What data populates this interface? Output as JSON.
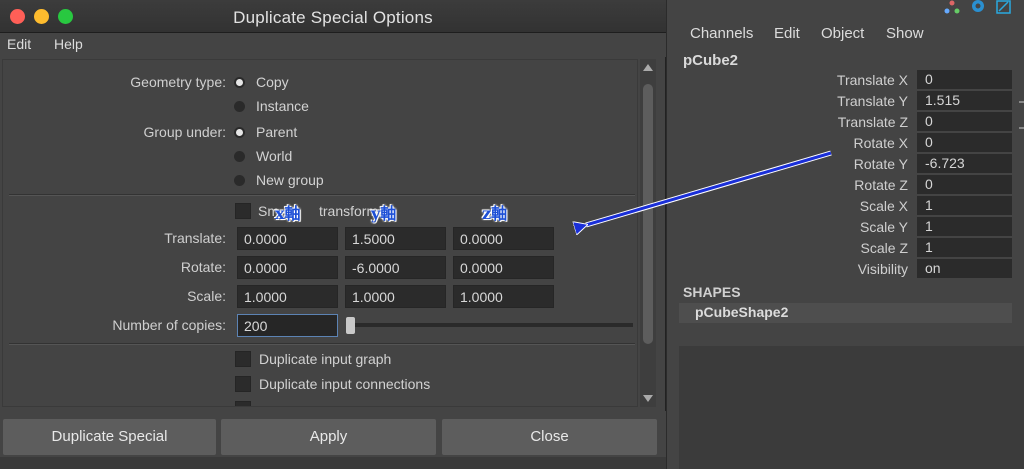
{
  "dialog": {
    "title": "Duplicate Special Options",
    "menu": [
      "Edit",
      "Help"
    ],
    "geometry_type": {
      "label": "Geometry type:",
      "options": [
        {
          "label": "Copy",
          "selected": true
        },
        {
          "label": "Instance",
          "selected": false
        }
      ]
    },
    "group_under": {
      "label": "Group under:",
      "options": [
        {
          "label": "Parent",
          "selected": true
        },
        {
          "label": "World",
          "selected": false
        },
        {
          "label": "New group",
          "selected": false
        }
      ]
    },
    "smart_transform": {
      "label_visible": "Sm",
      "label_tail": "transform"
    },
    "axis_annotations": [
      "x軸",
      "y軸",
      "z軸"
    ],
    "translate": {
      "label": "Translate:",
      "values": [
        "0.0000",
        "1.5000",
        "0.0000"
      ]
    },
    "rotate": {
      "label": "Rotate:",
      "values": [
        "0.0000",
        "-6.0000",
        "0.0000"
      ]
    },
    "scale": {
      "label": "Scale:",
      "values": [
        "1.0000",
        "1.0000",
        "1.0000"
      ]
    },
    "copies": {
      "label": "Number of copies:",
      "value": "200"
    },
    "checks": [
      {
        "label": "Duplicate input graph",
        "checked": false
      },
      {
        "label": "Duplicate input connections",
        "checked": false
      }
    ],
    "buttons": {
      "duplicate": "Duplicate Special",
      "apply": "Apply",
      "close": "Close"
    }
  },
  "channel_box": {
    "menu": [
      "Channels",
      "Edit",
      "Object",
      "Show"
    ],
    "object": "pCube2",
    "attributes": [
      {
        "label": "Translate X",
        "value": "0"
      },
      {
        "label": "Translate Y",
        "value": "1.515"
      },
      {
        "label": "Translate Z",
        "value": "0"
      },
      {
        "label": "Rotate X",
        "value": "0"
      },
      {
        "label": "Rotate Y",
        "value": "-6.723"
      },
      {
        "label": "Rotate Z",
        "value": "0"
      },
      {
        "label": "Scale X",
        "value": "1"
      },
      {
        "label": "Scale Y",
        "value": "1"
      },
      {
        "label": "Scale Z",
        "value": "1"
      },
      {
        "label": "Visibility",
        "value": "on"
      }
    ],
    "shapes_header": "SHAPES",
    "shape": "pCubeShape2"
  },
  "colors": {
    "annotation_arrow": "#1a2fd8",
    "close_light": "#ff5f57",
    "minimize_light": "#febc2e",
    "maximize_light": "#28c840"
  }
}
